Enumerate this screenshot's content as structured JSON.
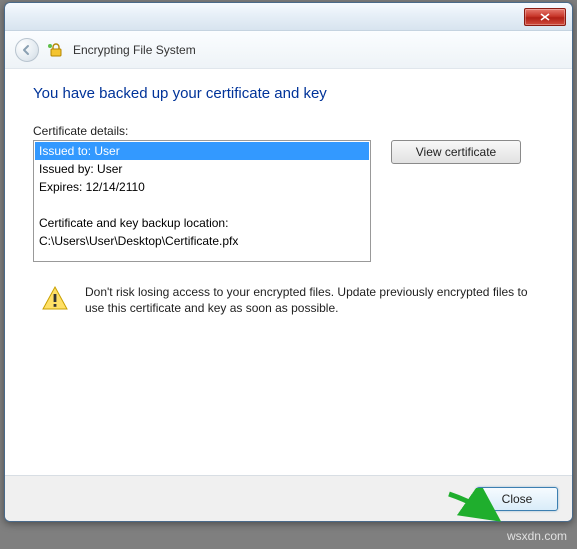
{
  "window": {
    "title": "Encrypting File System"
  },
  "main": {
    "heading": "You have backed up your certificate and key",
    "details_label": "Certificate details:",
    "issued_to": "Issued to: User",
    "issued_by": "Issued by: User",
    "expires": "Expires: 12/14/2110",
    "backup_label": "Certificate and key backup location:",
    "backup_path": "C:\\Users\\User\\Desktop\\Certificate.pfx",
    "view_cert_label": "View certificate",
    "warning_text": "Don't risk losing access to your encrypted files. Update previously encrypted files to use this certificate and key as soon as possible."
  },
  "footer": {
    "close_label": "Close"
  },
  "watermark": "wsxdn.com"
}
